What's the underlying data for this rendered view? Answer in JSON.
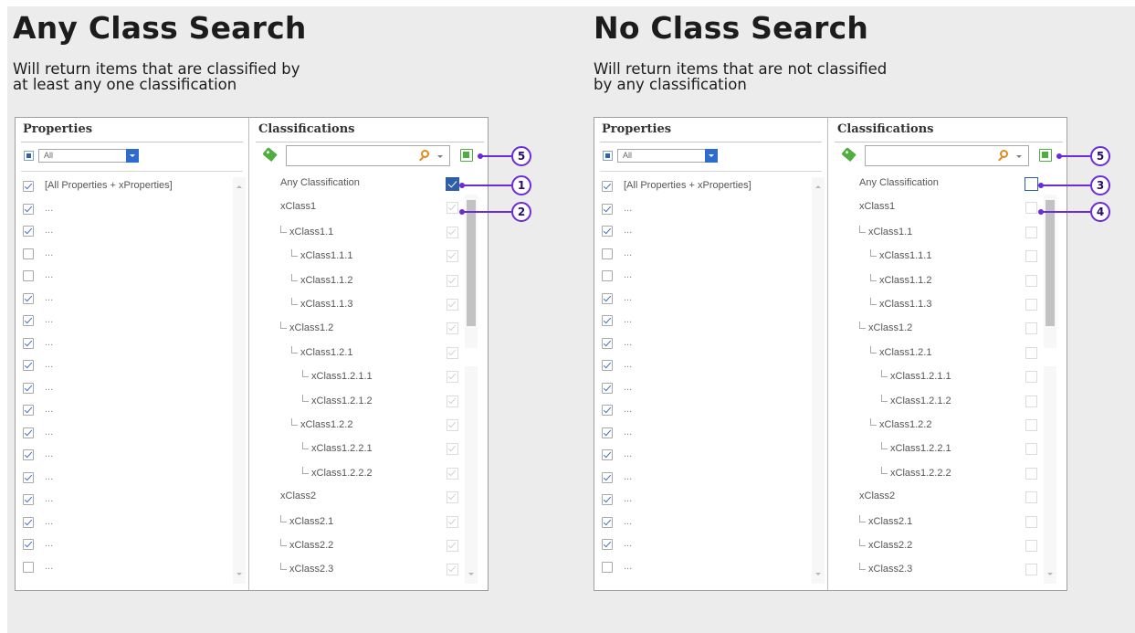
{
  "left": {
    "title": "Any Class Search",
    "description_line1": "Will return items that are classified by",
    "description_line2": "at least any one classification"
  },
  "right": {
    "title": "No Class Search",
    "description_line1": "Will return items that are not classified",
    "description_line2": "by any classification"
  },
  "properties_pane": {
    "title": "Properties",
    "filter_value": "All",
    "items": [
      {
        "label": "[All Properties + xProperties]",
        "checked": true
      },
      {
        "label": "...",
        "checked": true
      },
      {
        "label": "...",
        "checked": true
      },
      {
        "label": "...",
        "checked": false
      },
      {
        "label": "...",
        "checked": false
      },
      {
        "label": "...",
        "checked": true
      },
      {
        "label": "...",
        "checked": true
      },
      {
        "label": "...",
        "checked": true
      },
      {
        "label": "...",
        "checked": true
      },
      {
        "label": "...",
        "checked": true
      },
      {
        "label": "...",
        "checked": true
      },
      {
        "label": "...",
        "checked": true
      },
      {
        "label": "...",
        "checked": true
      },
      {
        "label": "...",
        "checked": true
      },
      {
        "label": "...",
        "checked": true
      },
      {
        "label": "...",
        "checked": true
      },
      {
        "label": "...",
        "checked": true
      },
      {
        "label": "...",
        "checked": false
      }
    ]
  },
  "classifications_pane": {
    "title": "Classifications",
    "search_value": "",
    "items": [
      {
        "label": "Any Classification",
        "level": 0
      },
      {
        "label": "xClass1",
        "level": 0
      },
      {
        "label": "xClass1.1",
        "level": 1
      },
      {
        "label": "xClass1.1.1",
        "level": 2
      },
      {
        "label": "xClass1.1.2",
        "level": 2
      },
      {
        "label": "xClass1.1.3",
        "level": 2
      },
      {
        "label": "xClass1.2",
        "level": 1
      },
      {
        "label": "xClass1.2.1",
        "level": 2
      },
      {
        "label": "xClass1.2.1.1",
        "level": 3
      },
      {
        "label": "xClass1.2.1.2",
        "level": 3
      },
      {
        "label": "xClass1.2.2",
        "level": 2
      },
      {
        "label": "xClass1.2.2.1",
        "level": 3
      },
      {
        "label": "xClass1.2.2.2",
        "level": 3
      },
      {
        "label": "xClass2",
        "level": 0
      },
      {
        "label": "xClass2.1",
        "level": 1
      },
      {
        "label": "xClass2.2",
        "level": 1
      },
      {
        "label": "xClass2.3",
        "level": 1
      }
    ]
  },
  "left_check_states": {
    "any_classification": "checked",
    "others": "checked-disabled"
  },
  "right_check_states": {
    "any_classification": "unchecked-highlighted",
    "others": "unchecked-disabled"
  },
  "callouts": {
    "left": [
      "5",
      "1",
      "2"
    ],
    "right": [
      "5",
      "3",
      "4"
    ]
  },
  "colors": {
    "callout": "#6b2bd8",
    "checkbox_accent": "#2e5ea8",
    "icon_green": "#4fae3f",
    "search_orange": "#e08a1e"
  },
  "icons": [
    "tag-icon",
    "search-icon",
    "apply-classification-icon",
    "dropdown-caret-icon"
  ]
}
